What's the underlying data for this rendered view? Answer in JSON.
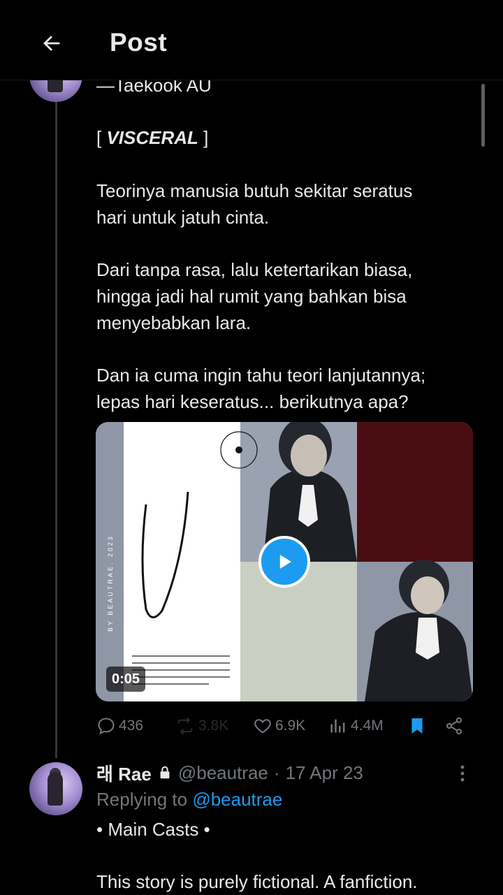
{
  "header": {
    "title": "Post"
  },
  "post": {
    "partial_line": "—Taekook AU",
    "title_open": "[ ",
    "title": "VISCERAL",
    "title_close": " ]",
    "paragraph1_line1": "Teorinya manusia butuh sekitar seratus",
    "paragraph1_line2": "hari untuk jatuh cinta.",
    "paragraph2_line1": "Dari tanpa rasa, lalu ketertarikan biasa,",
    "paragraph2_line2": "hingga jadi hal rumit yang bahkan bisa",
    "paragraph2_line3": "menyebabkan lara.",
    "paragraph3_line1": "Dan ia cuma ingin tahu teori lanjutannya;",
    "paragraph3_line2": "lepas hari keseratus... berikutnya apa?",
    "media": {
      "duration": "0:05",
      "cover_vertical_text": "BY BEAUTRAE. 2023",
      "cover_letter": "V",
      "cover_circle_text": "UNIVERSE · ALTERNATE · UNIVERSE · ALTERNATE ·",
      "cover_definition": "(adj.) 'visərəl/ 1. instinctive or unreasoning; 2. of, relating to, or located on or among the viscera; 3. felt in or as if in the internal organs of the body."
    },
    "actions": {
      "replies": "436",
      "reposts": "3.8K",
      "likes": "6.9K",
      "views": "4.4M"
    }
  },
  "reply": {
    "display_name": "래 Rae",
    "handle": "@beautrae",
    "separator": "·",
    "date": "17 Apr 23",
    "replying_prefix": "Replying to ",
    "replying_handle": "@beautrae",
    "line1": "• Main Casts •",
    "line2": "This story is purely fictional. A fanfiction."
  },
  "colors": {
    "background": "#000000",
    "text": "#e7e9ea",
    "muted": "#71767b",
    "accent": "#1d9bf0",
    "cover_maroon": "#4a0d12",
    "cover_sage": "#c9cfc2"
  },
  "icons": {
    "back": "arrow-left-icon",
    "reply": "comment-icon",
    "repost": "repost-icon",
    "like": "heart-icon",
    "views": "analytics-icon",
    "bookmark": "bookmark-icon",
    "share": "share-icon",
    "lock": "lock-icon",
    "more": "more-vertical-icon"
  }
}
